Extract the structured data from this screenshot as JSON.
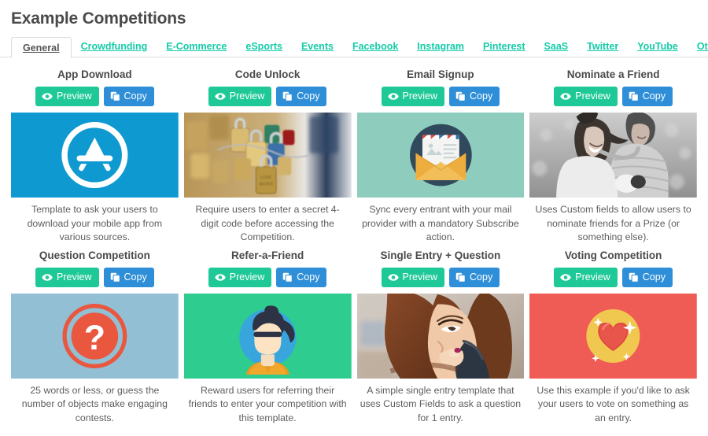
{
  "header": {
    "title": "Example Competitions"
  },
  "tabs": [
    {
      "label": "General",
      "active": true
    },
    {
      "label": "Crowdfunding",
      "active": false
    },
    {
      "label": "E-Commerce",
      "active": false
    },
    {
      "label": "eSports",
      "active": false
    },
    {
      "label": "Events",
      "active": false
    },
    {
      "label": "Facebook",
      "active": false
    },
    {
      "label": "Instagram",
      "active": false
    },
    {
      "label": "Pinterest",
      "active": false
    },
    {
      "label": "SaaS",
      "active": false
    },
    {
      "label": "Twitter",
      "active": false
    },
    {
      "label": "YouTube",
      "active": false
    },
    {
      "label": "Other Networks",
      "active": false
    }
  ],
  "buttons": {
    "preview_label": "Preview",
    "copy_label": "Copy"
  },
  "colors": {
    "tab_link": "#14cba8",
    "preview_button": "#1fc997",
    "copy_button": "#2e8fd8",
    "title_text": "#4a4a4a",
    "description_text": "#5d5d5d"
  },
  "cards": [
    {
      "title": "App Download",
      "description": "Template to ask your users to download your mobile app from various sources.",
      "thumb": {
        "kind": "illustration",
        "icon": "app-store-icon",
        "bg": "#0e9ad1"
      }
    },
    {
      "title": "Code Unlock",
      "description": "Require users to enter a secret 4-digit code before accessing the Competition.",
      "thumb": {
        "kind": "photo",
        "icon": "padlocks-photo",
        "bg": "#c2a15e"
      }
    },
    {
      "title": "Email Signup",
      "description": "Sync every entrant with your mail provider with a mandatory Subscribe action.",
      "thumb": {
        "kind": "illustration",
        "icon": "open-envelope-icon",
        "bg": "#8ecdbd"
      }
    },
    {
      "title": "Nominate a Friend",
      "description": "Uses Custom fields to allow users to nominate friends for a Prize (or something else).",
      "thumb": {
        "kind": "photo",
        "icon": "couple-photo",
        "bg": "#9a9a9a"
      }
    },
    {
      "title": "Question Competition",
      "description": "25 words or less, or guess the number of objects make engaging contests.",
      "thumb": {
        "kind": "illustration",
        "icon": "question-mark-icon",
        "bg": "#93bfd4"
      }
    },
    {
      "title": "Refer-a-Friend",
      "description": "Reward users for referring their friends to enter your competition with this template.",
      "thumb": {
        "kind": "illustration",
        "icon": "person-avatar-icon",
        "bg": "#2ecc8f"
      }
    },
    {
      "title": "Single Entry + Question",
      "description": "A simple single entry template that uses Custom Fields to ask a question for 1 entry.",
      "thumb": {
        "kind": "photo",
        "icon": "woman-on-phone-photo",
        "bg": "#7c5a4a"
      }
    },
    {
      "title": "Voting Competition",
      "description": "Use this example if you'd like to ask your users to vote on something as an entry.",
      "thumb": {
        "kind": "illustration",
        "icon": "heart-badge-icon",
        "bg": "#ef5b55"
      }
    }
  ]
}
